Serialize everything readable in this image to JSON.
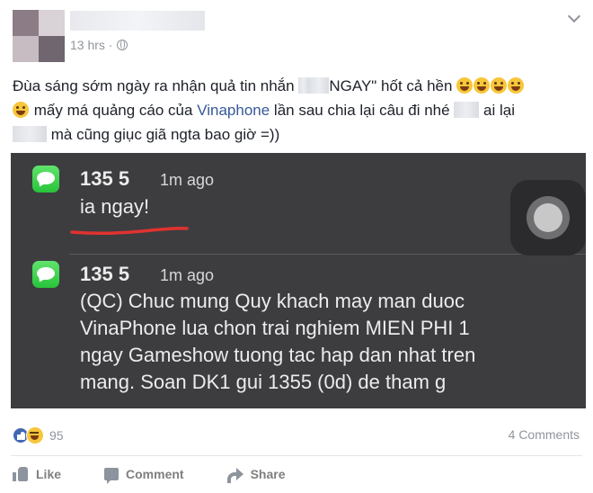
{
  "post": {
    "timestamp": "13 hrs",
    "privacy_icon": "globe-icon",
    "text": {
      "line1": "Đùa sáng sớm ngày ra nhận quả tin nhắn",
      "line1_quote_open": "\"",
      "line1_quote_rest": "NGAY\" hốt cả hền",
      "line2_after_emoji": "mấy má quảng cáo của",
      "brand_link": "Vinaphone",
      "line2_rest": "lần sau chia lại câu đi nhé",
      "line2_tail": "ai lại",
      "line3": "mà cũng giục giã ngta bao giờ =))"
    },
    "emojis": [
      "laughing-emoji",
      "laughing-emoji",
      "laughing-emoji",
      "laughing-emoji",
      "laughing-emoji"
    ]
  },
  "screenshot": {
    "notifications": [
      {
        "sender": "135 5",
        "time": "1m ago",
        "body": [
          "ia ngay!"
        ]
      },
      {
        "sender": "135 5",
        "time": "1m ago",
        "body": [
          "(QC) Chuc mung Quy khach may man duoc",
          "VinaPhone lua chon trai nghiem MIEN PHI 1",
          "ngay Gameshow tuong tac hap dan nhat tren",
          "mang. Soan DK1 gui 1355 (0d) de tham g"
        ]
      }
    ],
    "colors": {
      "background": "#3d3d40",
      "underline": "#e0322f",
      "message_icon": "#28c33a"
    }
  },
  "reactions": {
    "count": "95",
    "types": [
      "like-icon",
      "haha-icon"
    ]
  },
  "comments_count": "4 Comments",
  "actions": {
    "like": "Like",
    "comment": "Comment",
    "share": "Share"
  },
  "colors": {
    "link": "#365899",
    "meta": "#90949c",
    "like_blue": "#4267b2"
  }
}
